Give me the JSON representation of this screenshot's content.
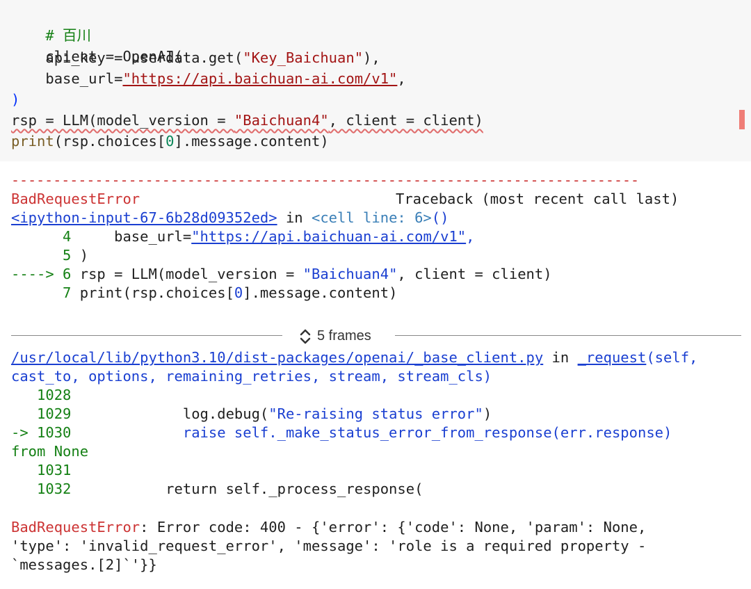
{
  "code": {
    "comment": "# 百川",
    "l2": "client = OpenAI(",
    "l3_a": "    api_key = userdata.get(",
    "l3_str": "\"Key_Baichuan\"",
    "l3_b": "),",
    "l4_a": "    base_url=",
    "l4_str": "\"https://api.baichuan-ai.com/v1\"",
    "l4_b": ",",
    "l5": ")",
    "l6_a": "rsp = LLM(model_version = ",
    "l6_str": "\"Baichuan4\"",
    "l6_b": ", client = client)",
    "l7_a": "print",
    "l7_b": "(rsp.choices[",
    "l7_num": "0",
    "l7_c": "].message.content)"
  },
  "output": {
    "dashes": "---------------------------------------------------------------------------",
    "error_name": "BadRequestError",
    "traceback_header": "Traceback (most recent call last)",
    "input_link": "<ipython-input-67-6b28d09352ed>",
    "in_word": " in ",
    "cell_line": "<cell line: 6>",
    "cell_paren": "()",
    "tb1_no": "      4",
    "tb1_a": "     base_url=",
    "tb1_url": "\"https://api.baichuan-ai.com/v1\"",
    "tb1_b": ",",
    "tb2_no": "      5",
    "tb2_a": " )",
    "tb3_arrow": "----> 6",
    "tb3_a": " rsp = LLM(model_version = ",
    "tb3_str": "\"Baichuan4\"",
    "tb3_b": ", client = client)",
    "tb4_no": "      7",
    "tb4_a": " print(rsp.choices[",
    "tb4_num": "0",
    "tb4_b": "].message.content)",
    "frames_label": "5 frames",
    "file_link": "/usr/local/lib/python3.10/dist-packages/openai/_base_client.py",
    "in_word2": " in ",
    "func": "_request",
    "args1": "(self,",
    "args2": "cast_to, options, remaining_retries, stream, stream_cls)",
    "f1_no": "   1028",
    "f2_no": "   1029",
    "f2_a": "             log.debug(",
    "f2_str": "\"Re-raising status error\"",
    "f2_b": ")",
    "f3_arrow": "-> 1030",
    "f3_a": "             raise self._make_status_error_from_response(err.response)",
    "f3_cont": "from None",
    "f4_no": "   1031",
    "f5_no": "   1032",
    "f5_a": "           return self._process_response(",
    "final_name": "BadRequestError",
    "final_msg1": ": Error code: 400 - {'error': {'code': None, 'param': None,",
    "final_msg2": "'type': 'invalid_request_error', 'message': 'role is a required property -",
    "final_msg3": "`messages.[2]`'}}"
  }
}
